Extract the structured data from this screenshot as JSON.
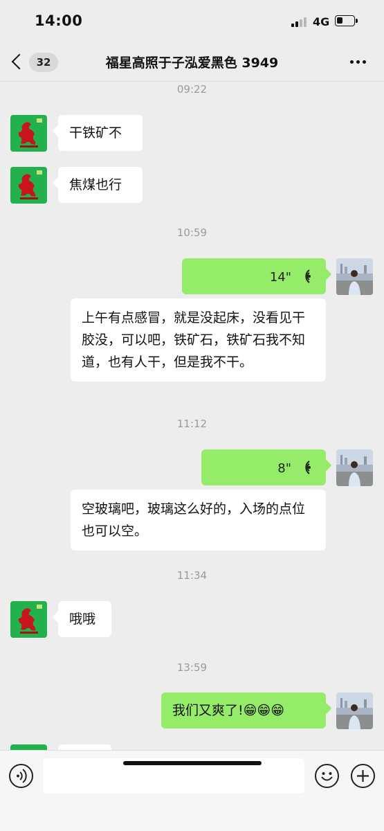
{
  "status_bar": {
    "time": "14:00",
    "network": "4G",
    "signal_bars": 4,
    "signal_bars_filled": 2,
    "battery_level": 0.35
  },
  "header": {
    "unread_count": "32",
    "title": "福星高照于子泓爱黑色 3949",
    "back_icon": "chevron-left-icon",
    "more_icon": "ellipsis-icon"
  },
  "messages": [
    {
      "timestamp": "09:22"
    },
    {
      "sender": "contact",
      "type": "text",
      "text": "干铁矿不"
    },
    {
      "sender": "contact",
      "type": "text",
      "text": "焦煤也行"
    },
    {
      "timestamp": "10:59"
    },
    {
      "sender": "me",
      "type": "voice",
      "duration": "14\"",
      "transcript": "上午有点感冒，就是没起床，没看见干胶没，可以吧，铁矿石，铁矿石我不知道，也有人干，但是我不干。"
    },
    {
      "timestamp": "11:12"
    },
    {
      "sender": "me",
      "type": "voice",
      "duration": "8\"",
      "transcript": "空玻璃吧，玻璃这么好的，入场的点位也可以空。"
    },
    {
      "timestamp": "11:34"
    },
    {
      "sender": "contact",
      "type": "text",
      "text": "哦哦"
    },
    {
      "timestamp": "13:59"
    },
    {
      "sender": "me",
      "type": "text",
      "text": "我们又爽了!😁😁😁"
    }
  ],
  "input_bar": {
    "voice_icon": "voice-mode-icon",
    "message_placeholder": "",
    "emoji_icon": "emoji-icon",
    "plus_icon": "plus-icon"
  },
  "colors": {
    "background": "#ededed",
    "outgoing_bubble": "#95ec69",
    "incoming_bubble": "#ffffff",
    "contact_avatar": "#22b14c",
    "timestamp_text": "#9a9a9a"
  }
}
